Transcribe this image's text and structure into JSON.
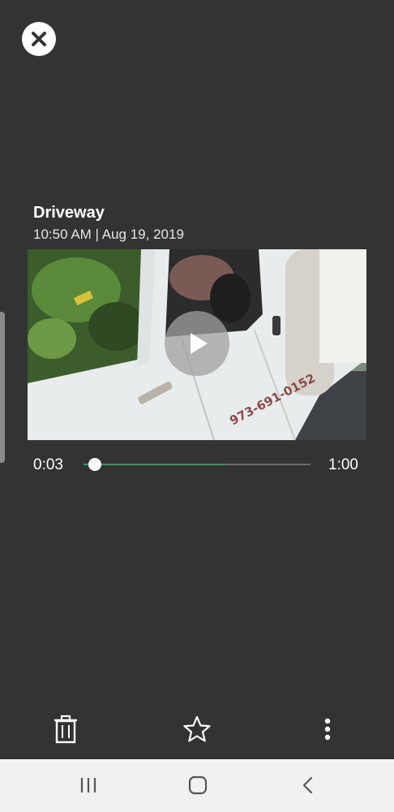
{
  "header": {
    "close_icon": "close-icon"
  },
  "clip": {
    "title": "Driveway",
    "timestamp": "10:50 AM | Aug 19, 2019",
    "truck_text": "973-691-0152"
  },
  "player": {
    "current_time": "0:03",
    "duration": "1:00",
    "progress": 0.05,
    "buffered": 0.63,
    "accent_color": "#4a8a66"
  },
  "toolbar": {
    "icons": [
      "trash-icon",
      "star-icon",
      "more-vertical-icon"
    ]
  },
  "navbar": {
    "icons": [
      "recents-icon",
      "home-icon",
      "back-icon"
    ]
  }
}
